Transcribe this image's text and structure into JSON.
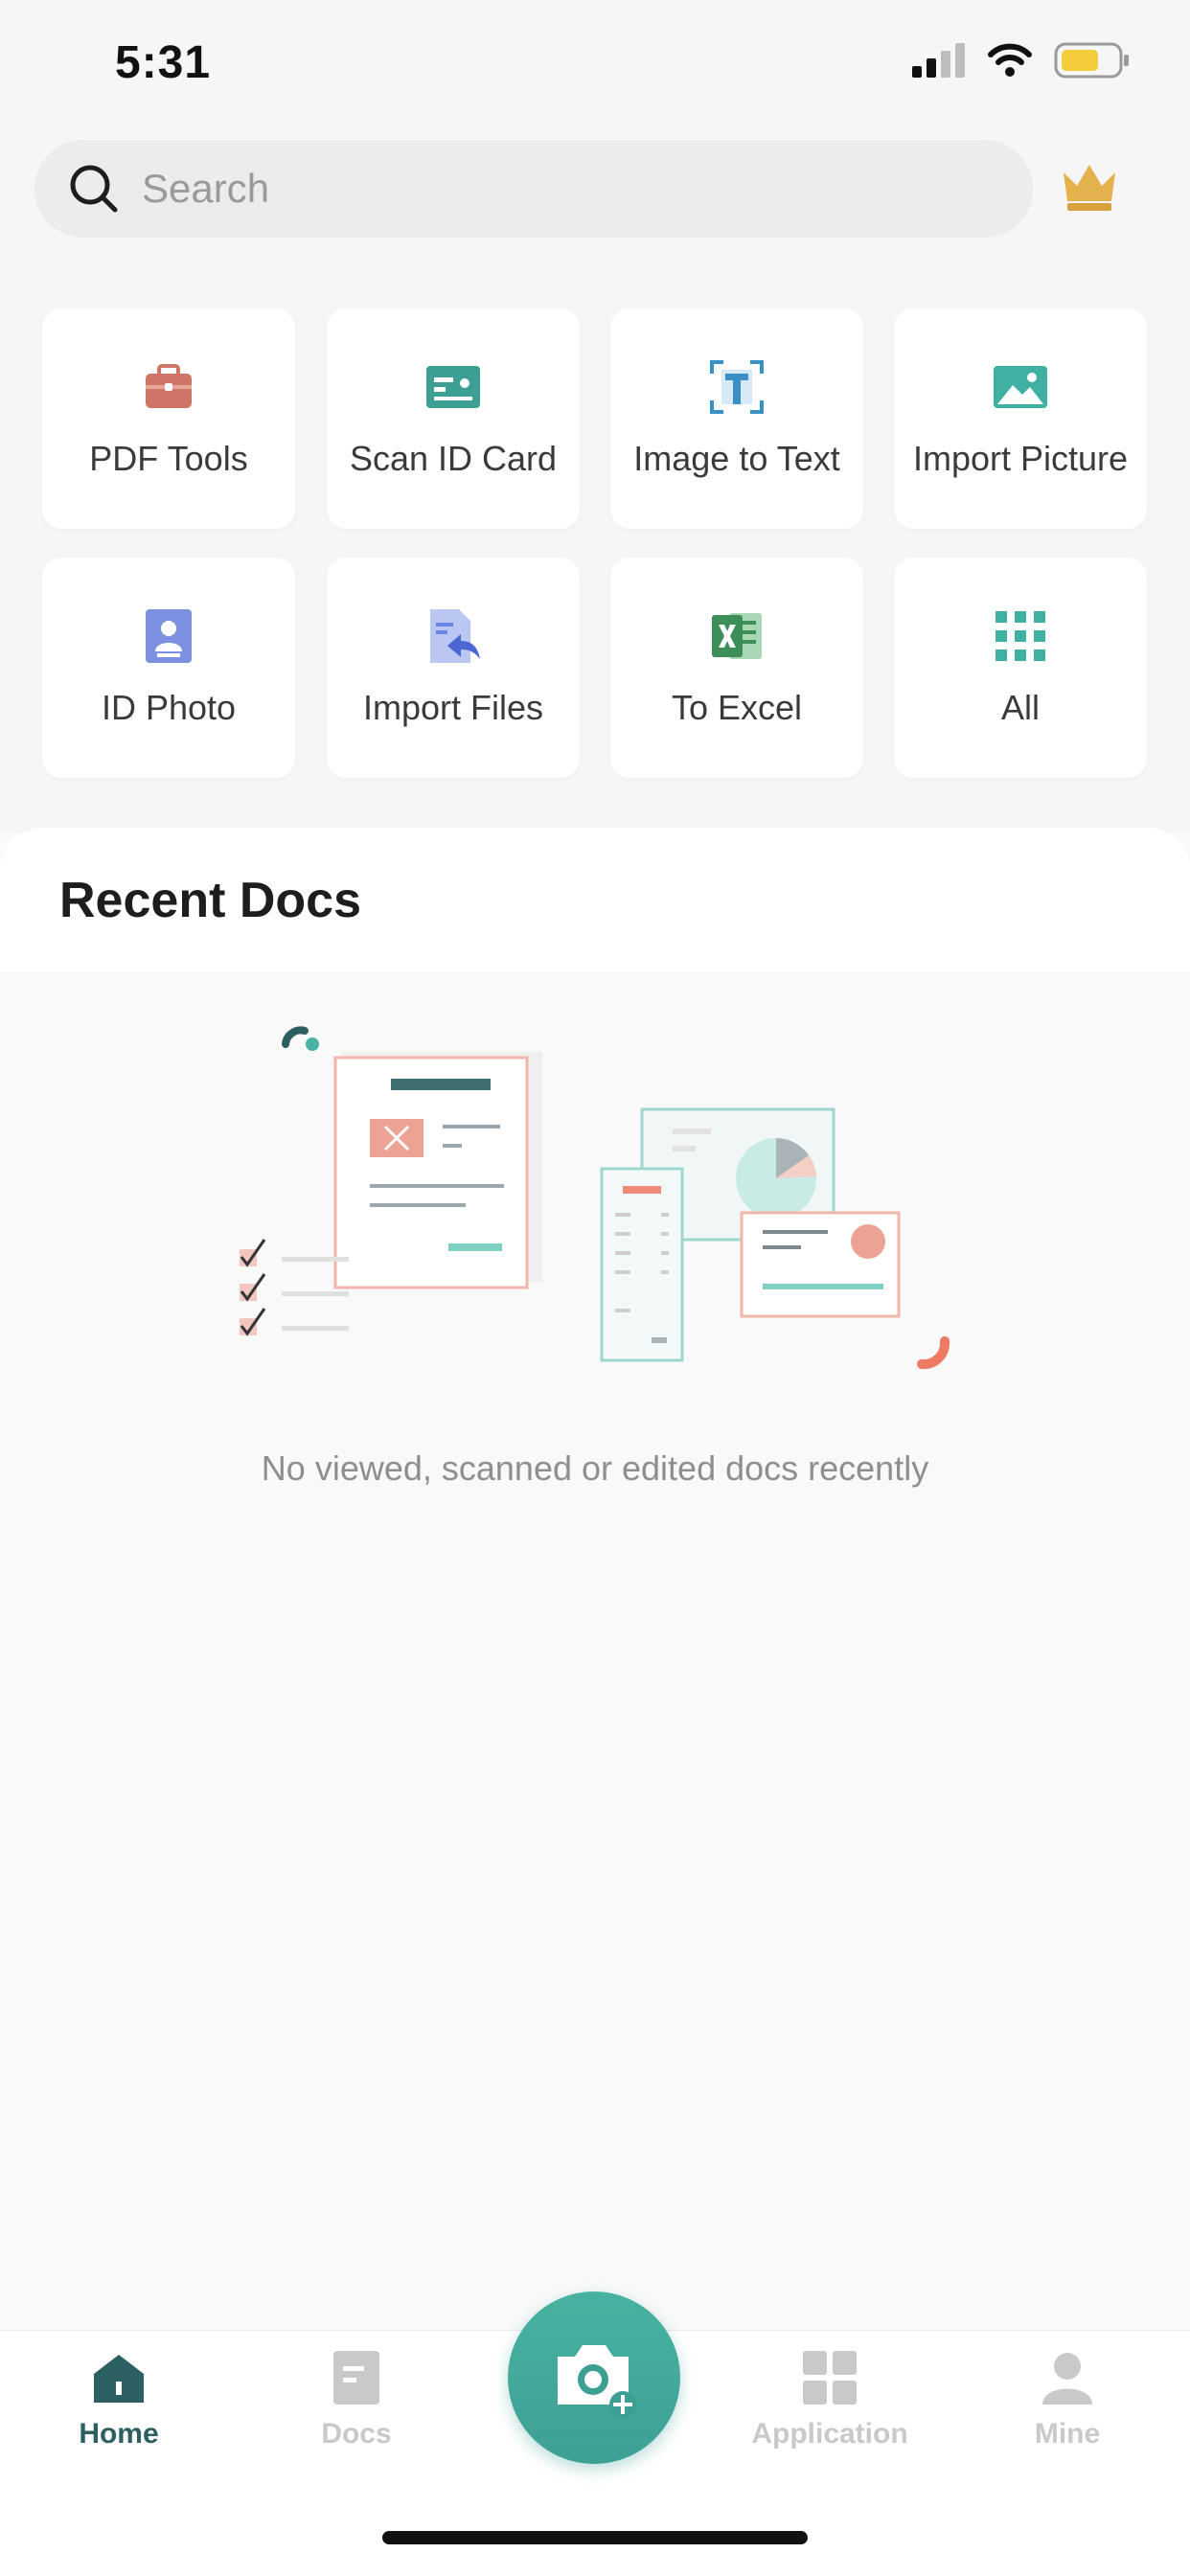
{
  "status_bar": {
    "time": "5:31"
  },
  "search": {
    "placeholder": "Search"
  },
  "tools": [
    {
      "label": "PDF Tools",
      "icon": "briefcase-icon"
    },
    {
      "label": "Scan ID Card",
      "icon": "id-card-icon"
    },
    {
      "label": "Image to Text",
      "icon": "text-scan-icon"
    },
    {
      "label": "Import Picture",
      "icon": "picture-icon"
    },
    {
      "label": "ID Photo",
      "icon": "id-photo-icon"
    },
    {
      "label": "Import Files",
      "icon": "import-files-icon"
    },
    {
      "label": "To Excel",
      "icon": "excel-icon"
    },
    {
      "label": "All",
      "icon": "grid-icon"
    }
  ],
  "recent": {
    "title": "Recent Docs",
    "empty_message": "No viewed, scanned or edited docs recently"
  },
  "tabbar": {
    "tabs": [
      {
        "label": "Home",
        "icon": "home-icon",
        "active": true
      },
      {
        "label": "Docs",
        "icon": "docs-icon",
        "active": false
      },
      {
        "label": "Application",
        "icon": "application-icon",
        "active": false
      },
      {
        "label": "Mine",
        "icon": "user-icon",
        "active": false
      }
    ],
    "camera_icon": "camera-plus-icon"
  },
  "colors": {
    "accent": "#3d9f94",
    "tab_active": "#2b5f61",
    "tab_inactive": "#c9c9c9",
    "crown": "#e4b24d"
  }
}
